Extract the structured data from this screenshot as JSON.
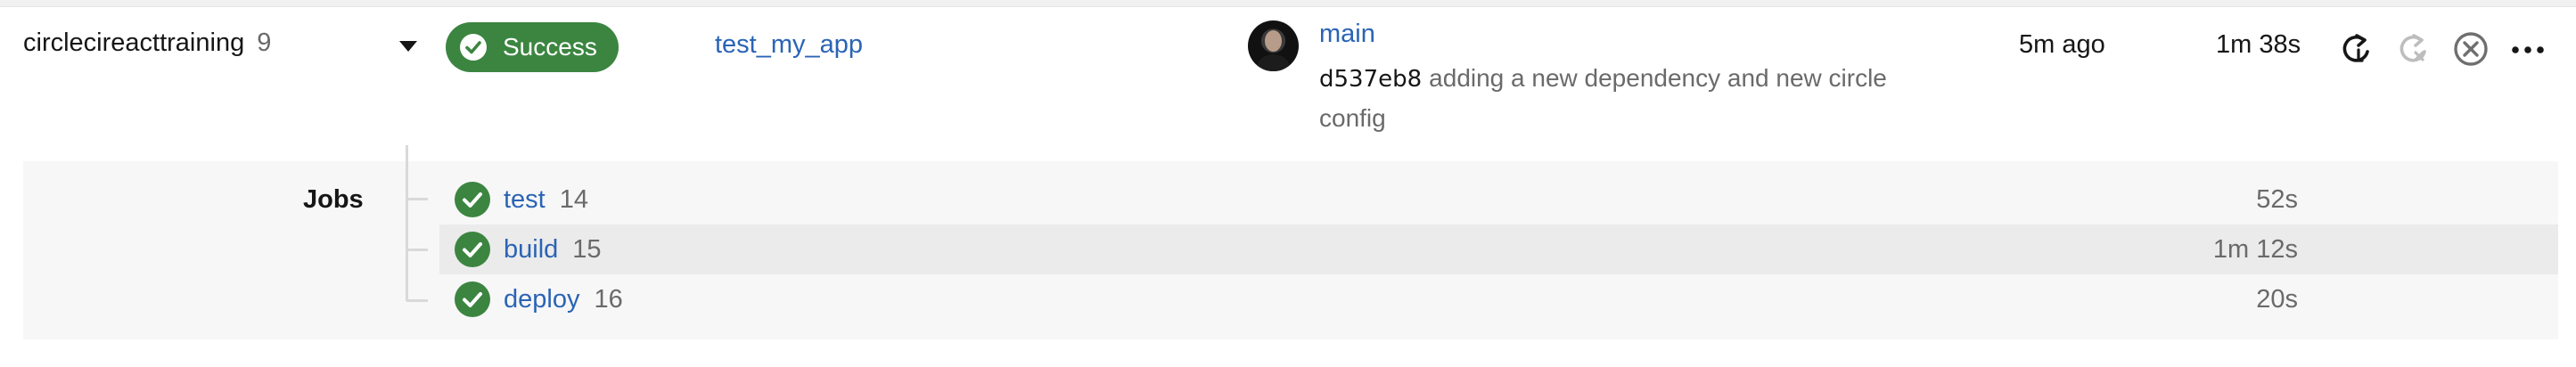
{
  "workflow": {
    "project": "circlecireacttraining",
    "number": "9",
    "status": "Success",
    "name": "test_my_app",
    "branch": "main",
    "commit_hash": "d537eb8",
    "commit_message": "adding a new dependency and new circle config",
    "time_ago": "5m ago",
    "duration": "1m 38s"
  },
  "actions": [
    "rerun-icon",
    "rerun-failed-icon",
    "cancel-icon",
    "more-icon"
  ],
  "jobs": {
    "label": "Jobs",
    "items": [
      {
        "name": "test",
        "number": "14",
        "duration": "52s",
        "status": "success"
      },
      {
        "name": "build",
        "number": "15",
        "duration": "1m 12s",
        "status": "success"
      },
      {
        "name": "deploy",
        "number": "16",
        "duration": "20s",
        "status": "success"
      }
    ]
  },
  "colors": {
    "success": "#3b8540",
    "link": "#2a64b5",
    "muted": "#6a6a6a"
  }
}
